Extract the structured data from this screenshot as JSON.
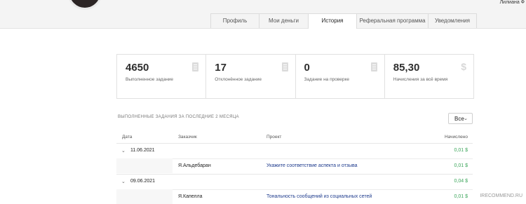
{
  "user": {
    "name": "Лилиана Ф"
  },
  "tabs": [
    {
      "label": "Профиль"
    },
    {
      "label": "Мои деньги"
    },
    {
      "label": "История",
      "active": true
    },
    {
      "label": "Реферальная программа"
    },
    {
      "label": "Уведомления"
    }
  ],
  "stats": [
    {
      "value": "4650",
      "label": "Выполненное задание",
      "icon": "document-icon"
    },
    {
      "value": "17",
      "label": "Отклонённое задание",
      "icon": "document-icon"
    },
    {
      "value": "0",
      "label": "Задание на проверке",
      "icon": "document-icon"
    },
    {
      "value": "85,30",
      "label": "Начисления за всё время",
      "icon": "dollar-icon"
    }
  ],
  "section": {
    "title": "ВЫПОЛНЕННЫЕ ЗАДАНИЯ ЗА ПОСЛЕДНИЕ 2 МЕСЯЦА"
  },
  "filter": {
    "value": "Все"
  },
  "table": {
    "headers": {
      "date": "Дата",
      "customer": "Заказчик",
      "project": "Проект",
      "credited": "Начислено"
    },
    "groups": [
      {
        "date": "11.06.2021",
        "amount": "0,01 $",
        "items": [
          {
            "customer": "Я.Альдебаран",
            "project": "Укажите соответствие аспекта и отзыва",
            "amount": "0,01 $"
          }
        ]
      },
      {
        "date": "09.06.2021",
        "amount": "0,04 $",
        "items": [
          {
            "customer": "Я.Капелла",
            "project": "Тональность сообщений из социальных сетей",
            "amount": "0,01 $"
          }
        ]
      }
    ]
  },
  "watermark": "IRECOMMEND.RU",
  "colors": {
    "accent_green": "#3ca65b",
    "link_blue": "#1d3a8c"
  }
}
